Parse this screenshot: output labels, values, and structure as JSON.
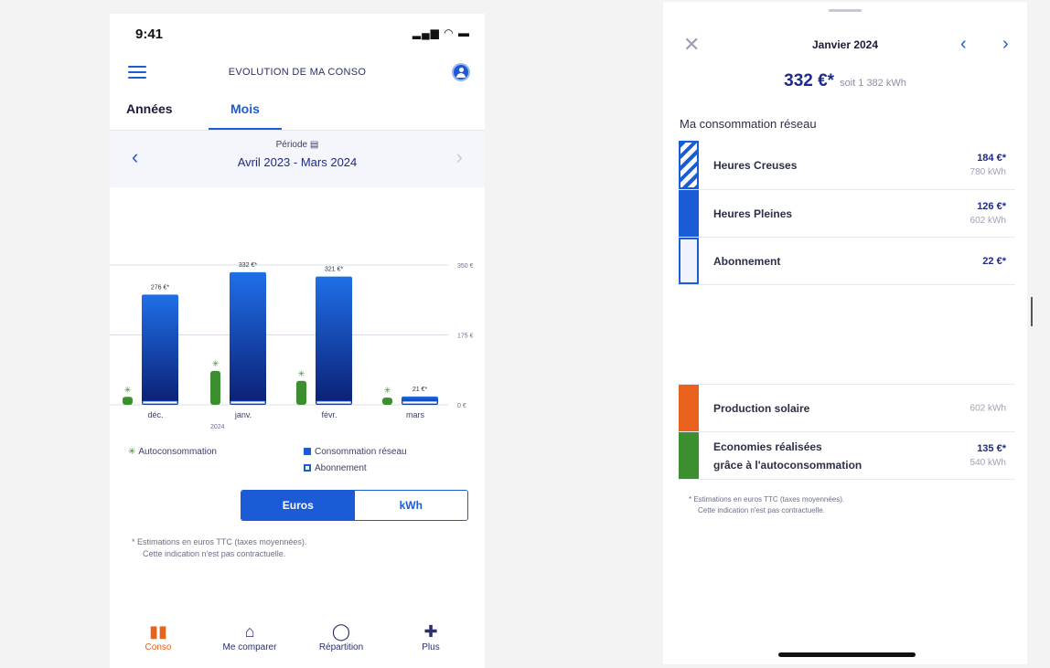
{
  "left": {
    "status_time": "9:41",
    "header_title": "EVOLUTION DE MA CONSO",
    "tabs": [
      {
        "label": "Années"
      },
      {
        "label": "Mois"
      }
    ],
    "period_label": "Période ▤",
    "period_value": "Avril 2023 - Mars 2024",
    "legend": {
      "autoconso": "Autoconsommation",
      "reseau": "Consommation réseau",
      "abonnement": "Abonnement"
    },
    "toggle": {
      "euros": "Euros",
      "kwh": "kWh"
    },
    "footnote_line1": "*  Estimations en euros TTC (taxes moyennées).",
    "footnote_line2": "Cette indication n'est pas contractuelle.",
    "nav": [
      {
        "label": "Conso",
        "icon": "bar-chart-icon"
      },
      {
        "label": "Me comparer",
        "icon": "house-icon"
      },
      {
        "label": "Répartition",
        "icon": "donut-icon"
      },
      {
        "label": "Plus",
        "icon": "plus-icon"
      }
    ],
    "colors": {
      "accent": "#1c5bd6",
      "green": "#3b8f2f",
      "orange": "#e8611d"
    }
  },
  "chart_data": {
    "type": "bar",
    "categories": [
      "déc.",
      "janv.",
      "févr.",
      "mars"
    ],
    "category_sublabels": [
      "",
      "2024",
      "",
      ""
    ],
    "series": [
      {
        "name": "Consommation réseau",
        "values": [
          276,
          332,
          321,
          21
        ]
      },
      {
        "name": "Autoconsommation",
        "values": [
          20,
          85,
          60,
          18
        ]
      }
    ],
    "data_labels": [
      "276 €*",
      "332 €*",
      "321 €*",
      "21 €*"
    ],
    "y_ticks": [
      {
        "value": 0,
        "label": "0 €"
      },
      {
        "value": 175,
        "label": "175 €"
      },
      {
        "value": 350,
        "label": "350 €"
      }
    ],
    "ylim": [
      0,
      350
    ],
    "grid": true
  },
  "right": {
    "title": "Janvier 2024",
    "amount": "332 €*",
    "amount_sub": "soit 1 382 kWh",
    "section": "Ma consommation réseau",
    "rows": [
      {
        "label": "Heures Creuses",
        "value": "184 €*",
        "kwh": "780 kWh"
      },
      {
        "label": "Heures Pleines",
        "value": "126 €*",
        "kwh": "602 kWh"
      },
      {
        "label": "Abonnement",
        "value": "22 €*"
      }
    ],
    "solar": {
      "label": "Production solaire",
      "kwh": "602 kWh"
    },
    "savings": {
      "label_line1": "Economies réalisées",
      "label_line2": "grâce à l'autoconsommation",
      "value": "135 €*",
      "kwh": "540 kWh"
    },
    "footnote_line1": "*  Estimations en euros TTC (taxes moyennées).",
    "footnote_line2": "Cette indication n'est pas contractuelle."
  }
}
